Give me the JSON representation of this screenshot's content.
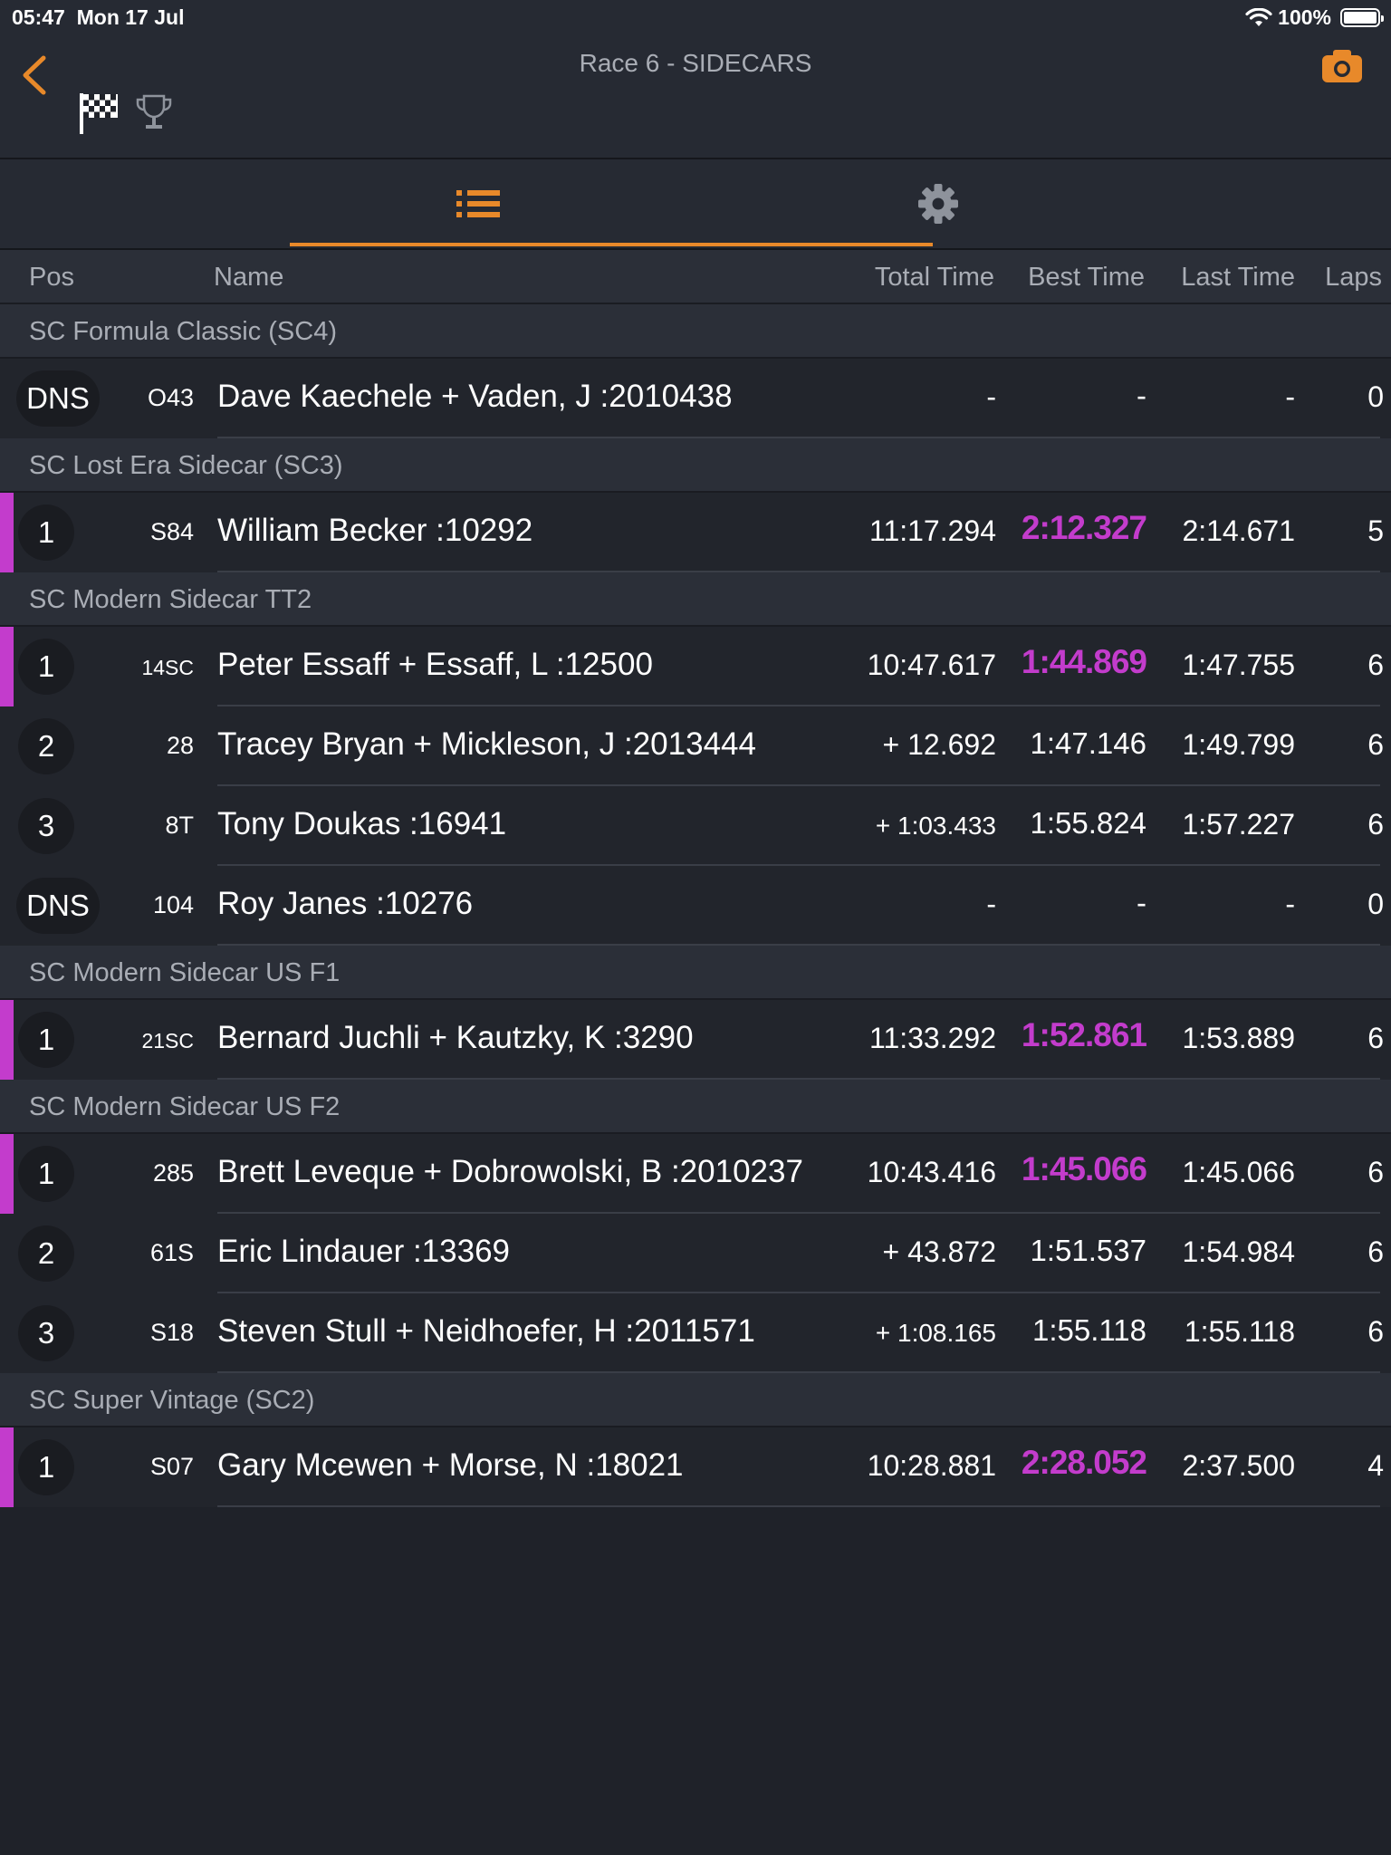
{
  "status_bar": {
    "time": "05:47",
    "date": "Mon 17 Jul",
    "battery": "100%"
  },
  "header": {
    "title": "Race 6 - SIDECARS",
    "accent_color": "#e8892a",
    "leader_color": "#c33ccc"
  },
  "columns": {
    "pos": "Pos",
    "name": "Name",
    "total": "Total Time",
    "best": "Best Time",
    "last": "Last Time",
    "laps": "Laps"
  },
  "groups": [
    {
      "label": "SC Formula Classic (SC4)",
      "rows": [
        {
          "pos": "DNS",
          "num": "O43",
          "name": "Dave Kaechele + Vaden, J :2010438",
          "total": "-",
          "best": "-",
          "last": "-",
          "laps": "0",
          "leader": false
        }
      ]
    },
    {
      "label": "SC Lost Era Sidecar (SC3)",
      "rows": [
        {
          "pos": "1",
          "num": "S84",
          "name": "William Becker :10292",
          "total": "11:17.294",
          "best": "2:12.327",
          "last": "2:14.671",
          "laps": "5",
          "leader": true
        }
      ]
    },
    {
      "label": "SC Modern Sidecar TT2",
      "rows": [
        {
          "pos": "1",
          "num": "14SC",
          "name": "Peter Essaff + Essaff, L :12500",
          "total": "10:47.617",
          "best": "1:44.869",
          "last": "1:47.755",
          "laps": "6",
          "leader": true
        },
        {
          "pos": "2",
          "num": "28",
          "name": "Tracey Bryan + Mickleson, J :2013444",
          "total": "+ 12.692",
          "best": "1:47.146",
          "last": "1:49.799",
          "laps": "6",
          "leader": false
        },
        {
          "pos": "3",
          "num": "8T",
          "name": "Tony Doukas :16941",
          "total": "+ 1:03.433",
          "best": "1:55.824",
          "last": "1:57.227",
          "laps": "6",
          "leader": false
        },
        {
          "pos": "DNS",
          "num": "104",
          "name": "Roy Janes :10276",
          "total": "-",
          "best": "-",
          "last": "-",
          "laps": "0",
          "leader": false
        }
      ]
    },
    {
      "label": "SC Modern Sidecar US F1",
      "rows": [
        {
          "pos": "1",
          "num": "21SC",
          "name": "Bernard Juchli + Kautzky, K :3290",
          "total": "11:33.292",
          "best": "1:52.861",
          "last": "1:53.889",
          "laps": "6",
          "leader": true
        }
      ]
    },
    {
      "label": "SC Modern Sidecar US F2",
      "rows": [
        {
          "pos": "1",
          "num": "285",
          "name": "Brett Leveque + Dobrowolski, B :2010237",
          "total": "10:43.416",
          "best": "1:45.066",
          "last": "1:45.066",
          "laps": "6",
          "leader": true
        },
        {
          "pos": "2",
          "num": "61S",
          "name": "Eric Lindauer :13369",
          "total": "+ 43.872",
          "best": "1:51.537",
          "last": "1:54.984",
          "laps": "6",
          "leader": false
        },
        {
          "pos": "3",
          "num": "S18",
          "name": "Steven Stull + Neidhoefer, H :2011571",
          "total": "+ 1:08.165",
          "best": "1:55.118",
          "last": "1:55.118",
          "laps": "6",
          "leader": false
        }
      ]
    },
    {
      "label": "SC Super Vintage (SC2)",
      "rows": [
        {
          "pos": "1",
          "num": "S07",
          "name": "Gary Mcewen + Morse, N :18021",
          "total": "10:28.881",
          "best": "2:28.052",
          "last": "2:37.500",
          "laps": "4",
          "leader": true
        }
      ]
    }
  ]
}
